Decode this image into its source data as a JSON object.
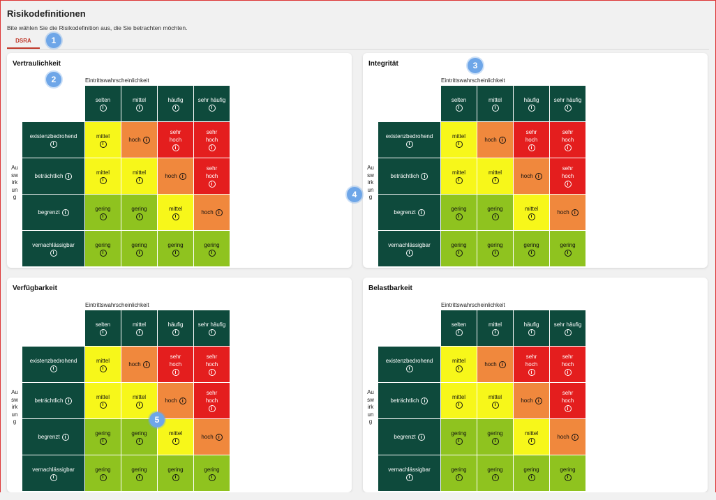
{
  "page": {
    "title": "Risikodefinitionen",
    "subtitle": "Bite wählen Sie die Risikodefinition aus, die Sie betrachten möchten.",
    "tab": "DSRA"
  },
  "colors": {
    "header": "#0e4a3c",
    "gering": "#8fc31f",
    "mittel": "#f7f71a",
    "hoch": "#f0883d",
    "sehr_hoch": "#e41e1e",
    "accent": "#c0392b"
  },
  "callouts": [
    "1",
    "2",
    "3",
    "4",
    "5"
  ],
  "matrix": {
    "x_label": "Eintrittswahrscheinlichkeit",
    "y_label": "Auswirkung",
    "info_icon": "info-icon",
    "columns": [
      "selten",
      "mittel",
      "häufig",
      "sehr häufig"
    ],
    "rows": [
      "existenzbedrohend",
      "beträchtlich",
      "begrenzt",
      "vernachlässigbar"
    ],
    "levels": [
      [
        "mittel",
        "hoch",
        "sehr hoch",
        "sehr hoch"
      ],
      [
        "mittel",
        "mittel",
        "hoch",
        "sehr hoch"
      ],
      [
        "gering",
        "gering",
        "mittel",
        "hoch"
      ],
      [
        "gering",
        "gering",
        "gering",
        "gering"
      ]
    ]
  },
  "cards": [
    {
      "title": "Vertraulichkeit"
    },
    {
      "title": "Integrität"
    },
    {
      "title": "Verfügbarkeit"
    },
    {
      "title": "Belastbarkeit"
    }
  ]
}
